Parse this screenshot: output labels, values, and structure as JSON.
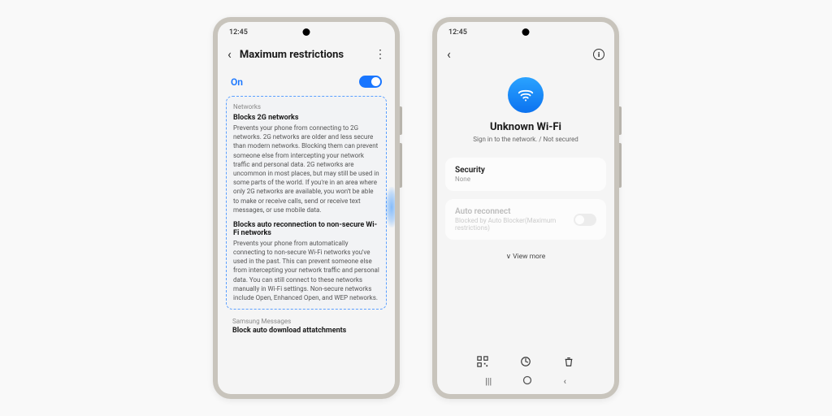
{
  "status_time": "12:45",
  "phone1": {
    "title": "Maximum restrictions",
    "toggle_label": "On",
    "toggle_state": true,
    "section1_label": "Networks",
    "item1_title": "Blocks 2G networks",
    "item1_desc": "Prevents your phone from connecting to 2G networks. 2G networks are older and less secure than modern networks. Blocking them can prevent someone else from intercepting your network traffic and personal data. 2G networks are uncommon in most places, but may still be used in some parts of the world. If you're in an area where only 2G networks are available, you won't be able to make or receive calls, send or receive text messages, or use mobile data.",
    "item2_title": "Blocks auto reconnection to non-secure Wi-Fi networks",
    "item2_desc": "Prevents your phone from automatically connecting to non-secure Wi-Fi networks you've used in the past. This can prevent someone else from intercepting your network traffic and personal data. You can still connect to these networks manually in Wi-Fi settings. Non-secure networks include Open, Enhanced Open, and WEP networks.",
    "section2_label": "Samsung Messages",
    "item3_title": "Block auto download attatchments"
  },
  "phone2": {
    "wifi_name": "Unknown Wi-Fi",
    "wifi_sub": "Sign in to the network. / Not secured",
    "security_label": "Security",
    "security_value": "None",
    "auto_label": "Auto reconnect",
    "auto_sub": "Blocked by Auto Blocker(Maximum restrictions)",
    "auto_state": false,
    "view_more": "View more"
  }
}
